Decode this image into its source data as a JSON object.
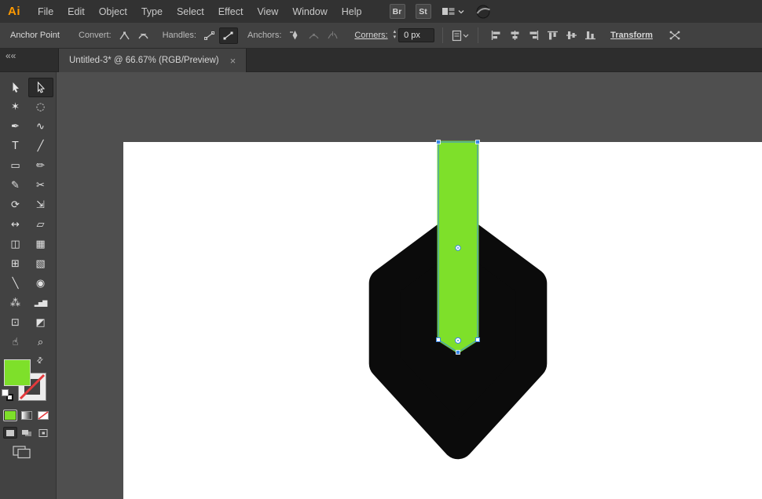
{
  "app": {
    "logo": "Ai",
    "menus": [
      "File",
      "Edit",
      "Object",
      "Type",
      "Select",
      "Effect",
      "View",
      "Window",
      "Help"
    ],
    "bridge_button": "Br",
    "stock_button": "St"
  },
  "control_bar": {
    "context_label": "Anchor Point",
    "convert_label": "Convert:",
    "handles_label": "Handles:",
    "anchors_label": "Anchors:",
    "corners_label": "Corners:",
    "corners_value": "0 px",
    "transform_label": "Transform"
  },
  "tab": {
    "title": "Untitled-3* @ 66.67% (RGB/Preview)",
    "close_label": "×",
    "collapse_label": "««"
  },
  "toolbar": {
    "tools": [
      {
        "name": "Selection Tool",
        "glyph": ""
      },
      {
        "name": "Direct Selection Tool",
        "glyph": "",
        "selected": true
      },
      {
        "name": "Magic Wand Tool",
        "glyph": "✶"
      },
      {
        "name": "Lasso Tool",
        "glyph": "◌"
      },
      {
        "name": "Pen Tool",
        "glyph": "✒"
      },
      {
        "name": "Curvature Tool",
        "glyph": "∿"
      },
      {
        "name": "Type Tool",
        "glyph": "T"
      },
      {
        "name": "Line Segment Tool",
        "glyph": "╱"
      },
      {
        "name": "Rectangle Tool",
        "glyph": "▭"
      },
      {
        "name": "Paintbrush Tool",
        "glyph": "✏"
      },
      {
        "name": "Shaper Tool",
        "glyph": "✎"
      },
      {
        "name": "Scissors Tool",
        "glyph": "✂"
      },
      {
        "name": "Rotate Tool",
        "glyph": "⟳"
      },
      {
        "name": "Scale Tool",
        "glyph": "⇲"
      },
      {
        "name": "Width Tool",
        "glyph": "↔"
      },
      {
        "name": "Free Transform Tool",
        "glyph": "▱"
      },
      {
        "name": "Shape Builder Tool",
        "glyph": "◫"
      },
      {
        "name": "Perspective Grid Tool",
        "glyph": "▦"
      },
      {
        "name": "Mesh Tool",
        "glyph": "⊞"
      },
      {
        "name": "Gradient Tool",
        "glyph": "▧"
      },
      {
        "name": "Eyedropper Tool",
        "glyph": "╲"
      },
      {
        "name": "Blend Tool",
        "glyph": "◉"
      },
      {
        "name": "Symbol Sprayer Tool",
        "glyph": "⁂"
      },
      {
        "name": "Column Graph Tool",
        "glyph": "▂▅▇"
      },
      {
        "name": "Artboard Tool",
        "glyph": "⊡"
      },
      {
        "name": "Slice Tool",
        "glyph": "◩"
      },
      {
        "name": "Hand Tool",
        "glyph": "☝"
      },
      {
        "name": "Zoom Tool",
        "glyph": "⌕"
      }
    ]
  },
  "colors": {
    "fill_green": "#7EE02A",
    "artwork_black": "#0B0B0B",
    "selection_blue": "#3A87E8",
    "logo_orange": "#FF9A00",
    "none_red": "#E3393C",
    "handle_white": "#FFFFFF"
  }
}
